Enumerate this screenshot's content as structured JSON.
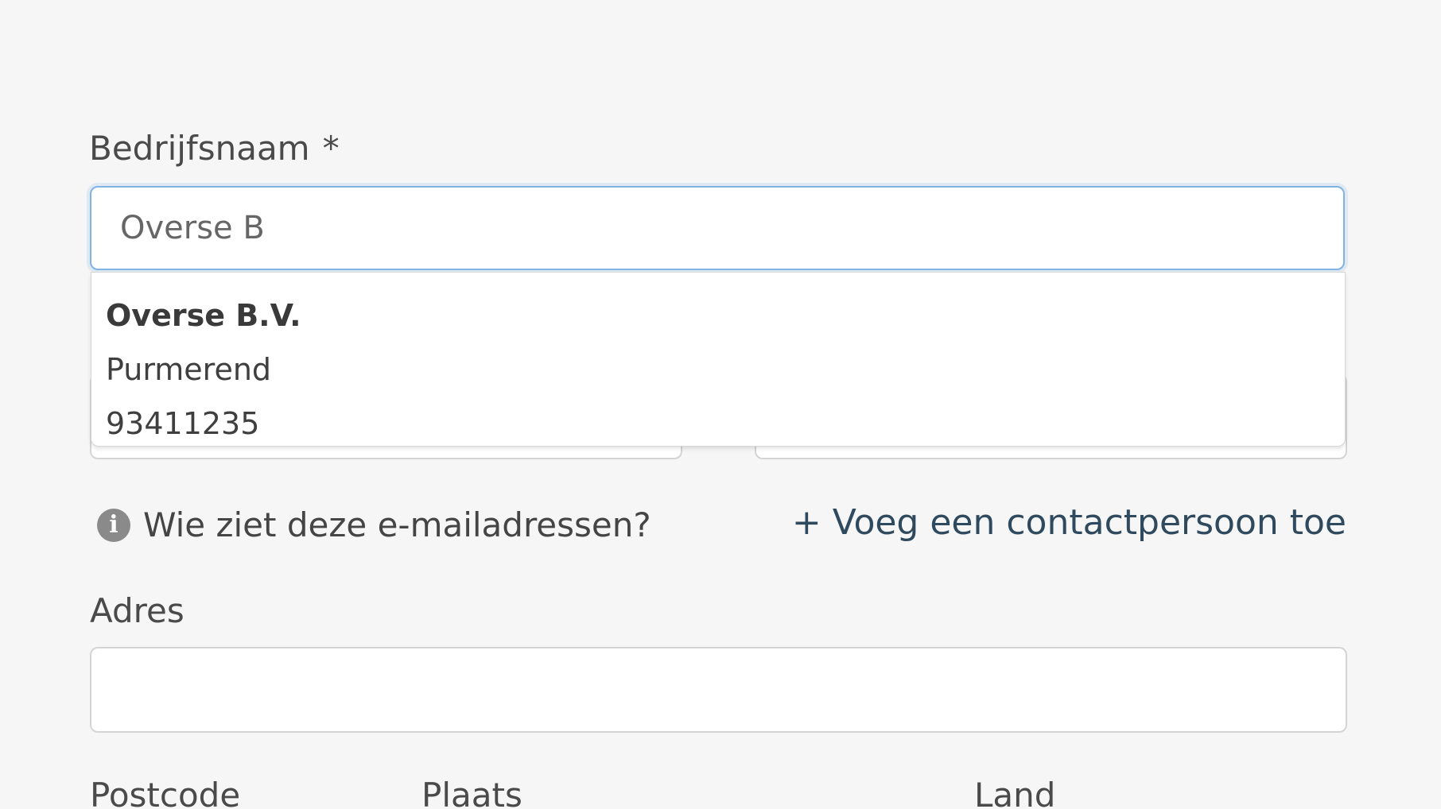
{
  "company_field": {
    "label": "Bedrijfsnaam",
    "required_marker": "*",
    "value": "Overse B"
  },
  "autocomplete": {
    "suggestion": {
      "name": "Overse B.V.",
      "city": "Purmerend",
      "registration_number": "93411235"
    }
  },
  "info": {
    "icon": "info-icon",
    "glyph": "i",
    "text": "Wie ziet deze e-mailadressen?"
  },
  "add_contact": {
    "label": "+ Voeg een contactpersoon toe",
    "color": "#2f4a5e"
  },
  "address_field": {
    "label": "Adres",
    "value": ""
  },
  "bottom_labels": {
    "postal_code": "Postcode",
    "city": "Plaats",
    "country": "Land"
  },
  "colors": {
    "focus_border": "#7fb3e6",
    "background": "#f6f6f6"
  }
}
